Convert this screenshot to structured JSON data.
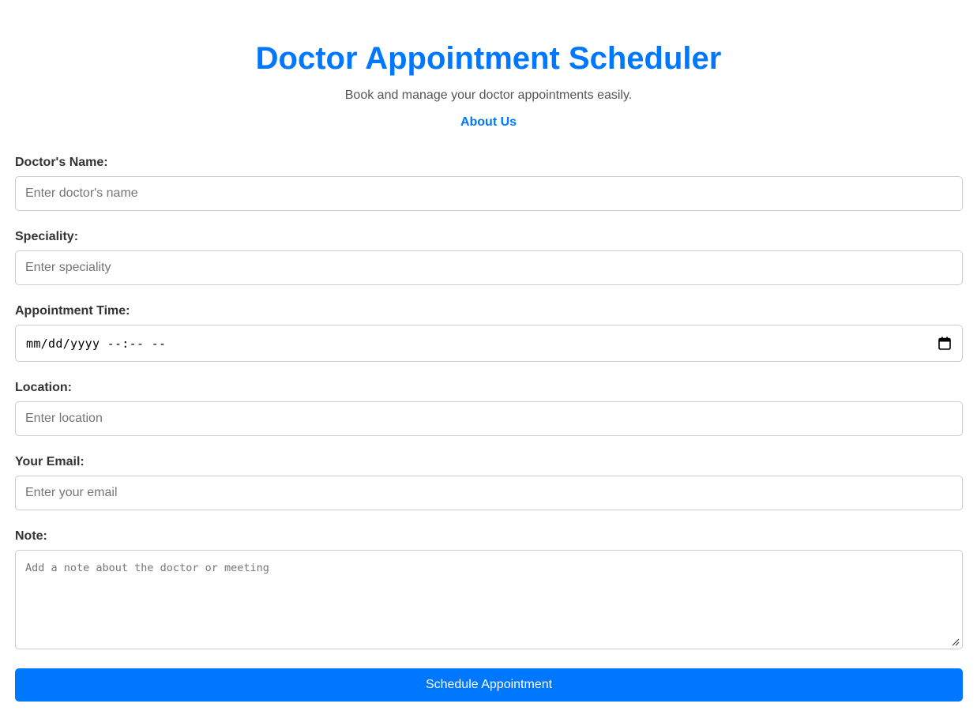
{
  "header": {
    "title": "Doctor Appointment Scheduler",
    "subtitle": "Book and manage your doctor appointments easily.",
    "about_link": "About Us"
  },
  "form": {
    "doctor_name": {
      "label": "Doctor's Name:",
      "placeholder": "Enter doctor's name",
      "value": ""
    },
    "speciality": {
      "label": "Speciality:",
      "placeholder": "Enter speciality",
      "value": ""
    },
    "appointment_time": {
      "label": "Appointment Time:",
      "display": "mm/dd/yyyy --:-- --",
      "icon": "calendar-icon"
    },
    "location": {
      "label": "Location:",
      "placeholder": "Enter location",
      "value": ""
    },
    "email": {
      "label": "Your Email:",
      "placeholder": "Enter your email",
      "value": ""
    },
    "note": {
      "label": "Note:",
      "placeholder": "Add a note about the doctor or meeting",
      "value": ""
    },
    "submit_label": "Schedule Appointment"
  },
  "colors": {
    "accent": "#0077ff",
    "label_text": "#333333",
    "subtitle_text": "#555555",
    "border": "#cccccc",
    "button_text": "#ffffff"
  }
}
